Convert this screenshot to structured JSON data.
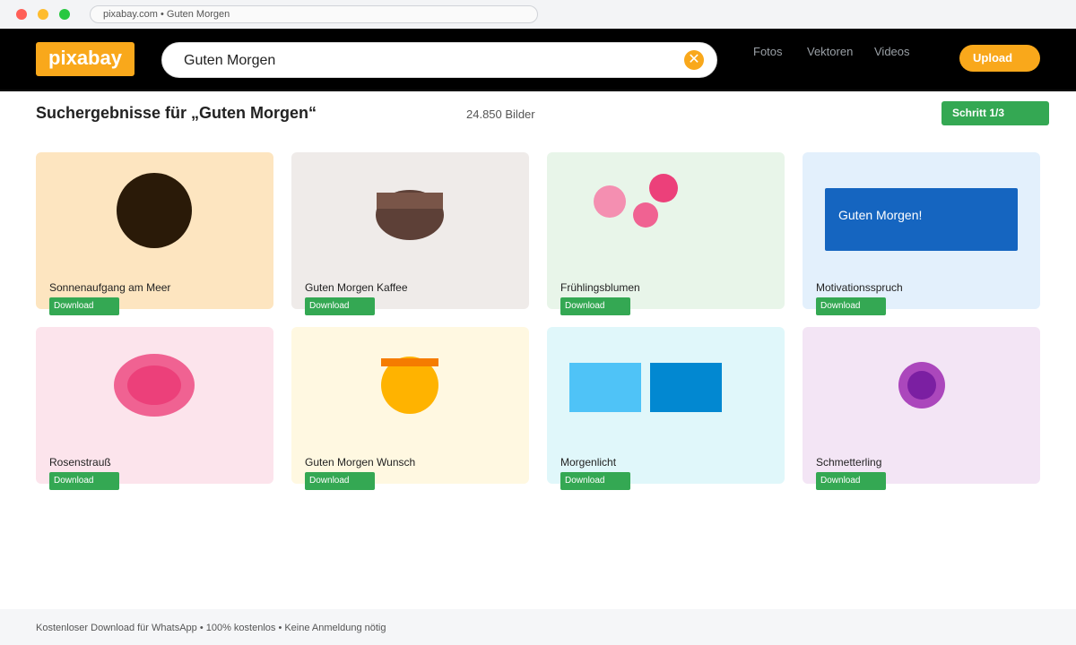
{
  "browser": {
    "url_text": "pixabay.com • Guten Morgen"
  },
  "header": {
    "logo": "pixabay",
    "search_value": "Guten Morgen",
    "nav": [
      "Fotos",
      "Vektoren",
      "Videos"
    ],
    "upload_label": "Upload"
  },
  "results": {
    "title": "Suchergebnisse für „Guten Morgen“",
    "count": "24.850 Bilder",
    "step_label": "Schritt 1/3"
  },
  "cards": [
    {
      "label": "Sonnenaufgang am Meer",
      "download": "Download",
      "bg": "#fde5c0"
    },
    {
      "label": "Guten Morgen Kaffee",
      "download": "Download",
      "bg": "#efebe9"
    },
    {
      "label": "Frühlingsblumen",
      "download": "Download",
      "bg": "#e8f5e9"
    },
    {
      "label": "Motivationsspruch",
      "download": "Download",
      "bg": "#e3f0fc",
      "banner_text": "Guten Morgen!"
    },
    {
      "label": "Rosenstrauß",
      "download": "Download",
      "bg": "#fce4ec"
    },
    {
      "label": "Guten Morgen Wunsch",
      "download": "Download",
      "bg": "#fff8e1"
    },
    {
      "label": "Morgenlicht",
      "download": "Download",
      "bg": "#e0f7fa"
    },
    {
      "label": "Schmetterling",
      "download": "Download",
      "bg": "#f3e5f5"
    }
  ],
  "footer": {
    "text": "Kostenloser Download für WhatsApp • 100% kostenlos • Keine Anmeldung nötig"
  },
  "colors": {
    "brand": "#f9a81b",
    "accent_green": "#34a853",
    "header_bg": "#000000"
  }
}
